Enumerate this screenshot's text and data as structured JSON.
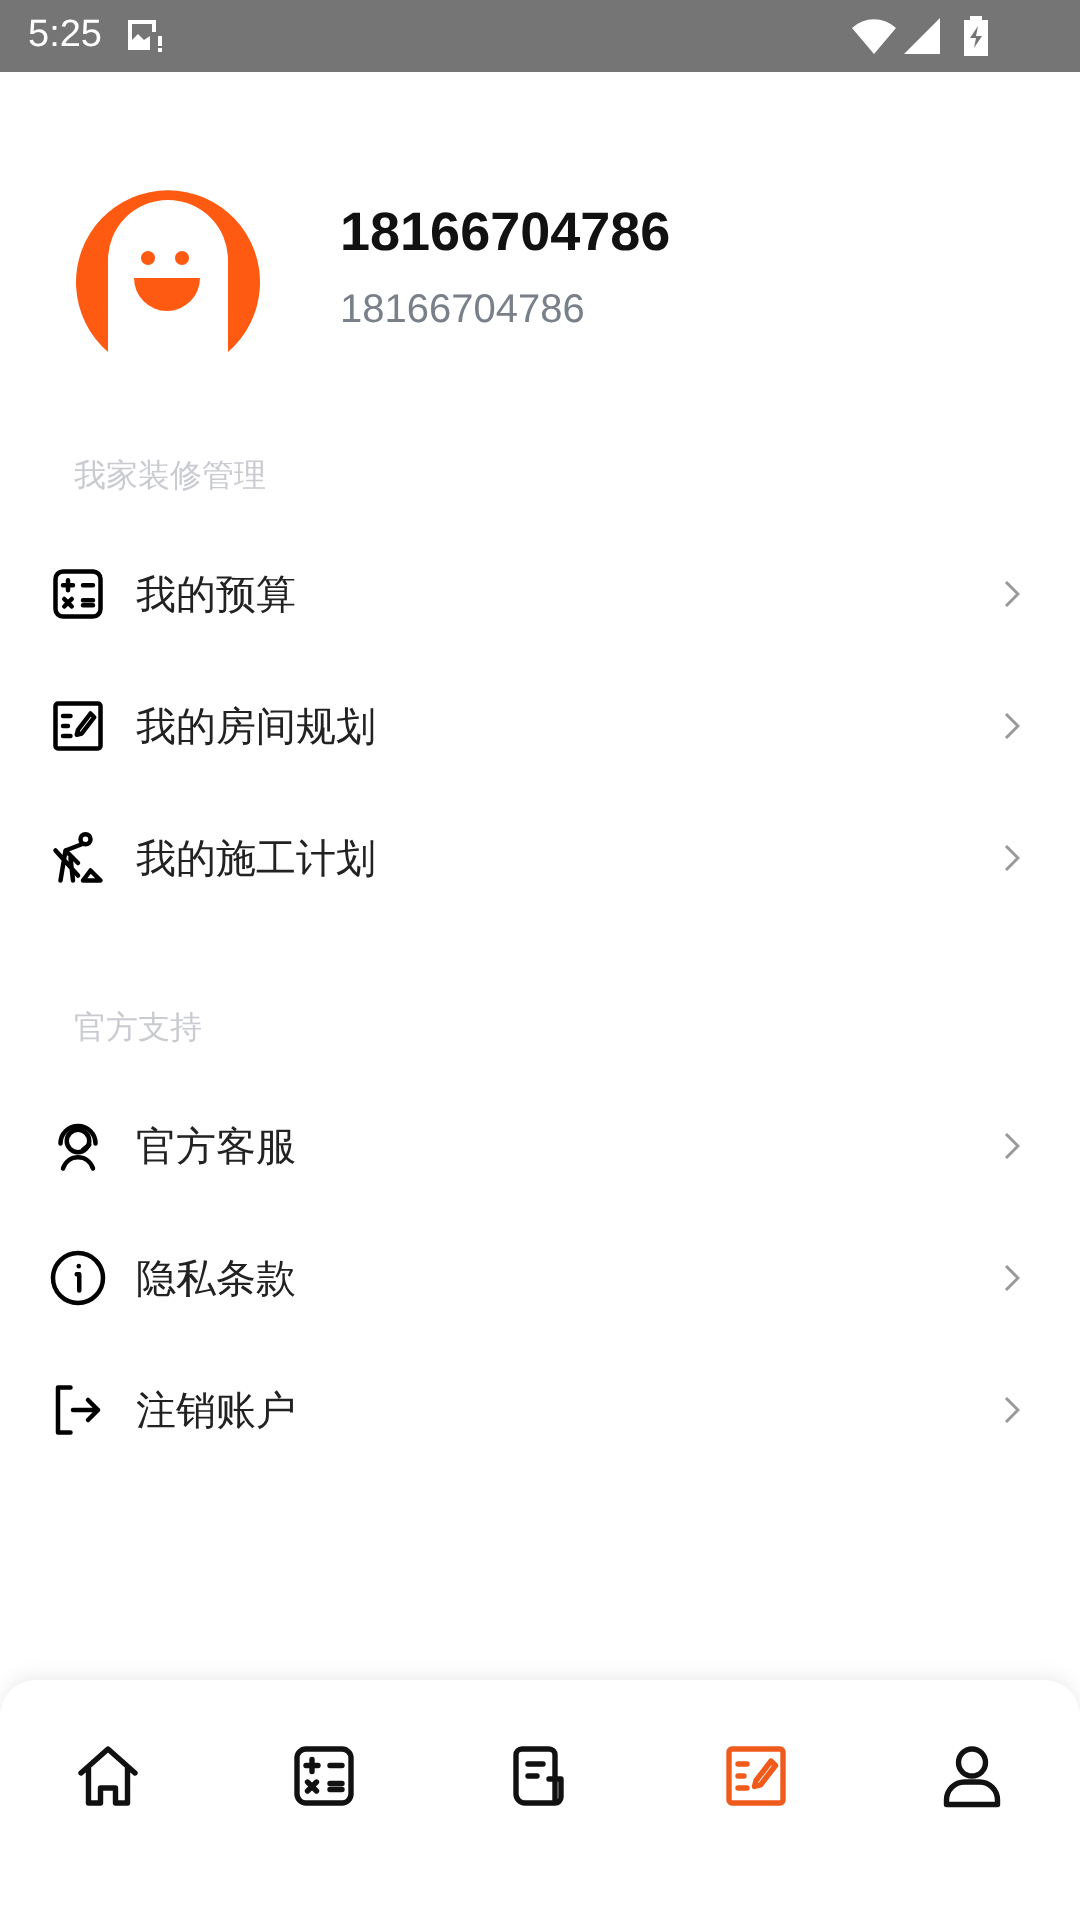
{
  "status_bar": {
    "time": "5:25"
  },
  "profile": {
    "name": "18166704786",
    "subtitle": "18166704786"
  },
  "sections": [
    {
      "title": "我家装修管理",
      "items": [
        {
          "kind": "calculator",
          "label": "我的预算"
        },
        {
          "kind": "plan",
          "label": "我的房间规划"
        },
        {
          "kind": "worker",
          "label": "我的施工计划"
        }
      ]
    },
    {
      "title": "官方支持",
      "items": [
        {
          "kind": "support",
          "label": "官方客服"
        },
        {
          "kind": "info",
          "label": "隐私条款"
        },
        {
          "kind": "logout",
          "label": "注销账户"
        }
      ]
    }
  ],
  "bottom_nav": [
    {
      "kind": "home",
      "selected": false
    },
    {
      "kind": "calculator",
      "selected": false
    },
    {
      "kind": "document",
      "selected": false
    },
    {
      "kind": "plan",
      "selected": true
    },
    {
      "kind": "profile",
      "selected": false
    }
  ]
}
